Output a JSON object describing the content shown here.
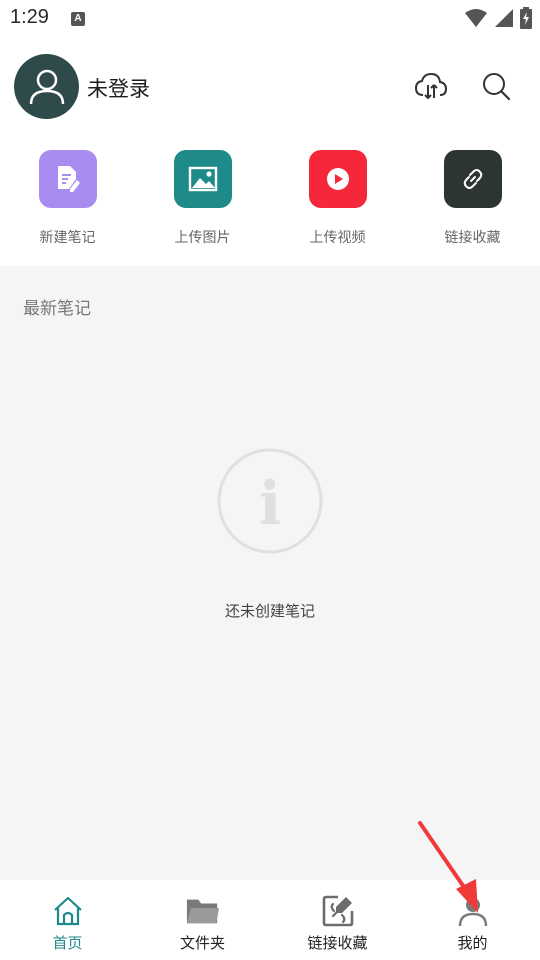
{
  "status": {
    "time": "1:29",
    "notification_glyph": "A"
  },
  "header": {
    "username": "未登录"
  },
  "quick_actions": [
    {
      "label": "新建笔记",
      "icon": "note-edit-icon",
      "color": "#a98cf0"
    },
    {
      "label": "上传图片",
      "icon": "image-icon",
      "color": "#1e8a8a"
    },
    {
      "label": "上传视频",
      "icon": "play-icon",
      "color": "#f5273a"
    },
    {
      "label": "链接收藏",
      "icon": "link-icon",
      "color": "#2d3434"
    }
  ],
  "content": {
    "section_title": "最新笔记",
    "empty_glyph": "i",
    "empty_text": "还未创建笔记"
  },
  "bottom_nav": [
    {
      "label": "首页",
      "icon": "home-icon",
      "active": true
    },
    {
      "label": "文件夹",
      "icon": "folder-icon",
      "active": false
    },
    {
      "label": "链接收藏",
      "icon": "link-edit-icon",
      "active": false
    },
    {
      "label": "我的",
      "icon": "person-icon",
      "active": false
    }
  ],
  "colors": {
    "accent": "#1f8a8a",
    "avatar_bg": "#2f4a4a",
    "annotation_arrow": "#f03a3a"
  }
}
